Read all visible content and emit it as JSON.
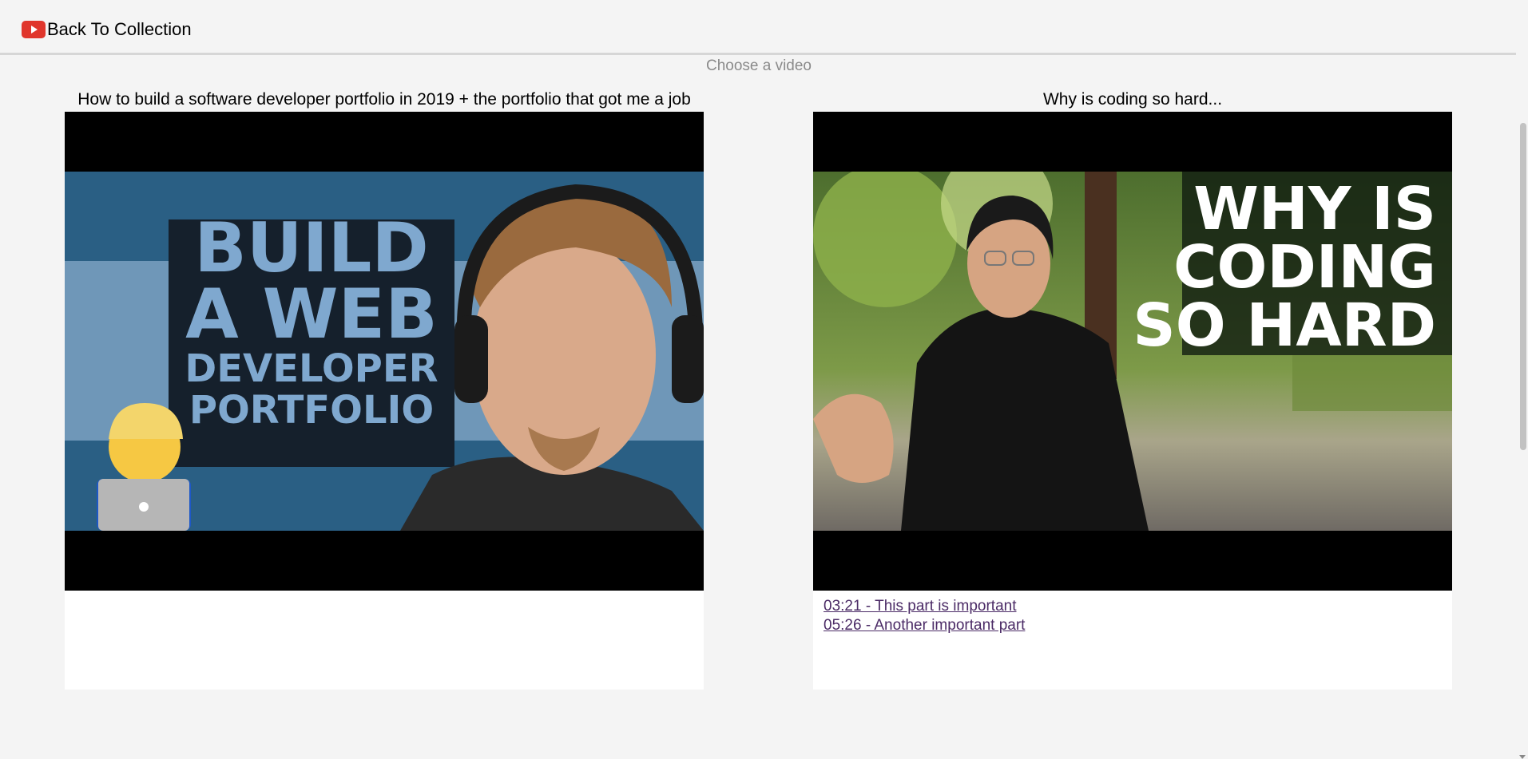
{
  "header": {
    "back_label": "Back To Collection",
    "icon": "youtube-icon"
  },
  "main": {
    "choose_label": "Choose a video",
    "videos": [
      {
        "title": "How to build a software developer portfolio in 2019 + the portfolio that got me a job",
        "thumbnail_text": [
          "BUILD",
          "A WEB",
          "DEVELOPER",
          "PORTFOLIO"
        ],
        "notes": []
      },
      {
        "title": "Why is coding so hard...",
        "thumbnail_text": [
          "WHY IS",
          "CODING",
          "SO HARD"
        ],
        "notes": [
          {
            "label": "03:21 - This part is important"
          },
          {
            "label": "05:26 - Another important part"
          }
        ]
      }
    ]
  },
  "colors": {
    "background": "#f4f4f4",
    "link": "#4b2b66",
    "youtube_red": "#e0362c",
    "thumb1_bg": "#2a5f84",
    "thumb1_text": "#7fa8cf"
  }
}
